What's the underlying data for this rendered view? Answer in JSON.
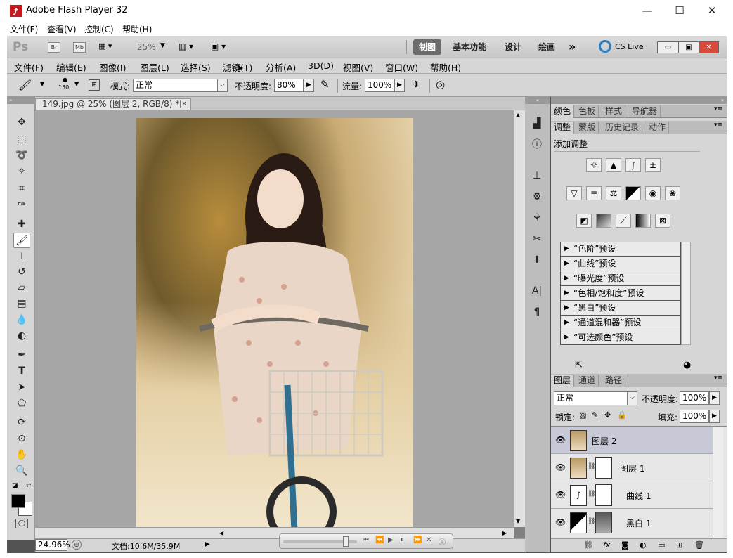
{
  "window": {
    "title": "Adobe Flash Player 32",
    "menu": [
      "文件(F)",
      "查看(V)",
      "控制(C)",
      "帮助(H)"
    ],
    "controls": {
      "minimize": "—",
      "maximize": "☐",
      "close": "✕"
    }
  },
  "appbar": {
    "ps_logo": "Ps",
    "bridge": "Br",
    "minibridge": "Mb",
    "zoom": "25%",
    "workspaces": [
      "制图",
      "基本功能",
      "设计",
      "绘画"
    ],
    "more": "»",
    "cslive": "CS Live"
  },
  "menubar": [
    "文件(F)",
    "编辑(E)",
    "图像(I)",
    "图层(L)",
    "选择(S)",
    "滤镜(T)",
    "分析(A)",
    "3D(D)",
    "视图(V)",
    "窗口(W)",
    "帮助(H)"
  ],
  "options": {
    "brush_size": "150",
    "mode_label": "模式:",
    "mode_value": "正常",
    "opacity_label": "不透明度:",
    "opacity_value": "80%",
    "flow_label": "流量:",
    "flow_value": "100%"
  },
  "document": {
    "tab_title": "149.jpg @ 25% (图层 2, RGB/8) *",
    "zoom_status": "24.96%",
    "doc_size": "文档:10.6M/35.9M"
  },
  "panels": {
    "group1_tabs": [
      "颜色",
      "色板",
      "样式",
      "导航器"
    ],
    "group2_tabs": [
      "调整",
      "蒙版",
      "历史记录",
      "动作"
    ],
    "add_adjustment": "添加调整",
    "presets": [
      "“色阶”预设",
      "“曲线”预设",
      "“曝光度”预设",
      "“色相/饱和度”预设",
      "“黑白”预设",
      "“通道混和器”预设",
      "“可选颜色”预设"
    ],
    "layers_tabs": [
      "图层",
      "通道",
      "路径"
    ],
    "blend_mode": "正常",
    "opacity_label": "不透明度:",
    "opacity_value": "100%",
    "lock_label": "锁定:",
    "fill_label": "填充:",
    "fill_value": "100%",
    "layers": [
      {
        "name": "图层 2"
      },
      {
        "name": "图层 1"
      },
      {
        "name": "曲线 1"
      },
      {
        "name": "黑白 1"
      }
    ]
  },
  "colors": {
    "accent_red": "#c8181f",
    "selected_layer": "#c7c9d6",
    "workspace_active": "#6b6b6b"
  }
}
